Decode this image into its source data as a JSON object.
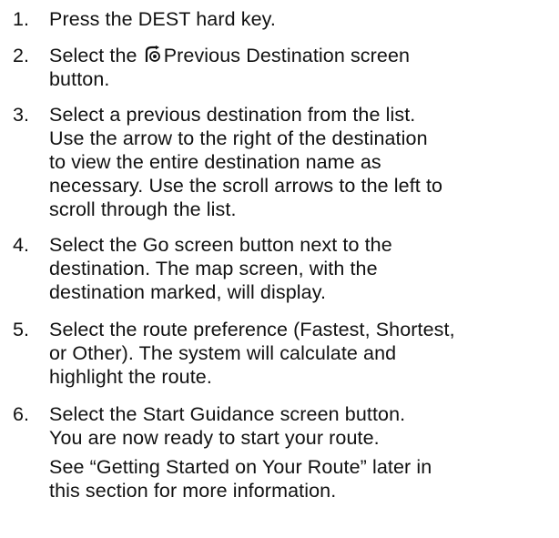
{
  "steps": [
    {
      "number": "1.",
      "lines": [
        "Press the DEST hard key."
      ]
    },
    {
      "number": "2.",
      "pre_icon": "Select the",
      "icon": "previous-destination-icon",
      "post_icon": "Previous Destination screen",
      "lines": [
        "button."
      ]
    },
    {
      "number": "3.",
      "lines": [
        "Select a previous destination from the list.",
        "Use the arrow to the right of the destination",
        "to view the entire destination name as",
        "necessary. Use the scroll arrows to the left to",
        "scroll through the list."
      ]
    },
    {
      "number": "4.",
      "lines": [
        "Select the Go screen button next to the",
        "destination. The map screen, with the",
        "destination marked, will display."
      ]
    },
    {
      "number": "5.",
      "lines": [
        "Select the route preference (Fastest, Shortest,",
        "or Other). The system will calculate and",
        "highlight the route."
      ]
    },
    {
      "number": "6.",
      "lines": [
        "Select the Start Guidance screen button.",
        "You are now ready to start your route."
      ],
      "note_lines": [
        "See “Getting Started on Your Route” later in",
        "this section for more information."
      ]
    }
  ]
}
